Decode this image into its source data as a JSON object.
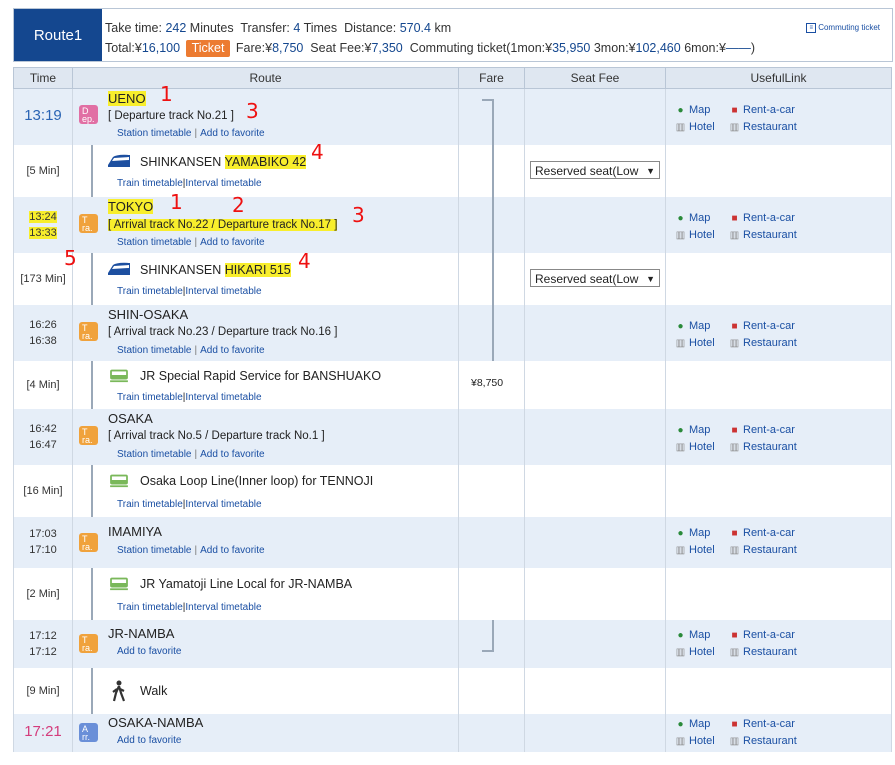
{
  "header": {
    "route_label": "Route1",
    "take_time_label": "Take time:",
    "take_time_value": "242",
    "take_time_unit": "Minutes",
    "transfer_label": "Transfer:",
    "transfer_value": "4",
    "transfer_unit": "Times",
    "distance_label": "Distance:",
    "distance_value": "570.4",
    "distance_unit": "km",
    "total_label": "Total:¥",
    "total_value": "16,100",
    "ticket_button": "Ticket",
    "fare_label": "Fare:¥",
    "fare_value": "8,750",
    "seat_fee_label": "Seat Fee:¥",
    "seat_fee_value": "7,350",
    "commuting_label": "Commuting ticket(1mon:¥",
    "commuting_1mon": "35,950",
    "commuting_3mon_label": "3mon:¥",
    "commuting_3mon": "102,460",
    "commuting_6mon_label": "6mon:¥",
    "commuting_6mon": "――",
    "commuting_close": ")",
    "commuting_ticket_link": "Commuting ticket"
  },
  "columns": {
    "time": "Time",
    "route": "Route",
    "fare": "Fare",
    "seat_fee": "Seat Fee",
    "useful_link": "UsefulLink"
  },
  "links": {
    "station_timetable": "Station timetable",
    "add_to_favorite": "Add to favorite",
    "train_timetable": "Train timetable",
    "interval_timetable": "Interval timetable",
    "map": "Map",
    "rent_a_car": "Rent-a-car",
    "hotel": "Hotel",
    "restaurant": "Restaurant",
    "sep": "|"
  },
  "badges": {
    "dep_1": "D",
    "dep_2": "ep.",
    "tra_1": "T",
    "tra_2": "ra.",
    "arr_1": "A",
    "arr_2": "rr."
  },
  "stations": [
    {
      "name": "UENO",
      "time1": "13:19",
      "track": "[ Departure track No.21 ]"
    },
    {
      "name": "TOKYO",
      "time1": "13:24",
      "time2": "13:33",
      "track": "[ Arrival track No.22 / Departure track No.17 ]"
    },
    {
      "name": "SHIN-OSAKA",
      "time1": "16:26",
      "time2": "16:38",
      "track": "[ Arrival track No.23 / Departure track No.16 ]"
    },
    {
      "name": "OSAKA",
      "time1": "16:42",
      "time2": "16:47",
      "track": "[ Arrival track No.5 / Departure track No.1 ]"
    },
    {
      "name": "IMAMIYA",
      "time1": "17:03",
      "time2": "17:10"
    },
    {
      "name": "JR-NAMBA",
      "time1": "17:12",
      "time2": "17:12"
    },
    {
      "name": "OSAKA-NAMBA",
      "time1": "17:21"
    }
  ],
  "segments": [
    {
      "duration": "[5 Min]",
      "line": "SHINKANSEN YAMABIKO 42",
      "seat": "Reserved seat(Low"
    },
    {
      "duration": "[173 Min]",
      "line": "SHINKANSEN HIKARI 515",
      "seat": "Reserved seat(Low"
    },
    {
      "duration": "[4 Min]",
      "line": "JR Special Rapid Service  for BANSHUAKO",
      "fare": "¥8,750"
    },
    {
      "duration": "[16 Min]",
      "line": "Osaka Loop Line(Inner loop)  for TENNOJI"
    },
    {
      "duration": "[2 Min]",
      "line": "JR Yamatoji Line Local  for JR-NAMBA"
    },
    {
      "duration": "[9 Min]",
      "line": "Walk"
    }
  ],
  "annotations": [
    "1",
    "2",
    "3",
    "4",
    "5"
  ],
  "colors": {
    "header_blue": "#14478f",
    "ticket_orange": "#ec7b31",
    "station_row": "#e6eef8",
    "highlight": "#f8ee2c",
    "annotation_red": "#e11"
  }
}
